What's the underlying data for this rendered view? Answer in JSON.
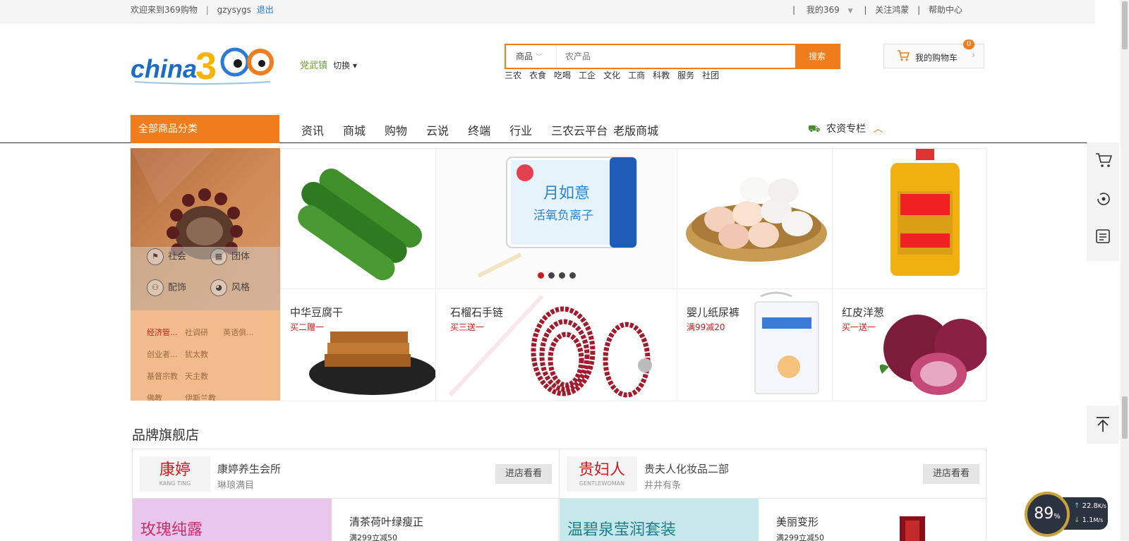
{
  "topbar": {
    "welcome": "欢迎来到369购物",
    "username": "gzysygs",
    "logout": "退出",
    "my369": "我的369",
    "follow": "关注鸿蒙",
    "help": "帮助中心"
  },
  "header": {
    "logo_text": "china369",
    "city": "党武镇",
    "city_switch": "切换",
    "search_category": "商品",
    "search_placeholder": "农产品",
    "search_button": "搜索",
    "hotwords": [
      "三农",
      "衣食",
      "吃喝",
      "工企",
      "文化",
      "工商",
      "科教",
      "服务",
      "社团"
    ],
    "cart_label": "我的购物车",
    "cart_count": "0"
  },
  "nav": {
    "all_categories": "全部商品分类",
    "items": [
      "资讯",
      "商城",
      "购物",
      "云说",
      "终端",
      "行业",
      "三农云平台",
      "老版商城"
    ],
    "special": "农资专栏"
  },
  "sidebar": {
    "items": [
      "社会",
      "团体",
      "配饰",
      "风格"
    ],
    "links": [
      "经济管...",
      "社调研",
      "英语俱...",
      "创业者...",
      "犹太教",
      "基督宗教",
      "天主教",
      "佛教",
      "伊斯兰教"
    ]
  },
  "promos": [
    {
      "title": "中华豆腐干",
      "sub": "买二赠一"
    },
    {
      "title": "石榴石手链",
      "sub": "买三送一"
    },
    {
      "title": "婴儿纸尿裤",
      "sub": "满99减20"
    },
    {
      "title": "红皮洋葱",
      "sub": "买一送一"
    }
  ],
  "banner": {
    "brand_label": "月如意",
    "brand_sub": "活氧负离子",
    "dots": 4,
    "active_dot": 0
  },
  "brands": {
    "section_title": "品牌旗舰店",
    "stores": [
      {
        "logo": "康婷",
        "logo_en": "KANG TING",
        "name": "康婷养生会所",
        "slogan": "琳琅满目",
        "enter": "进店看看",
        "banner_text": "玫瑰纯露",
        "banner_color": "#e9c6ec",
        "product_title": "清茶荷叶绿瘦正",
        "product_sub": "满299立减50"
      },
      {
        "logo": "贵妇人",
        "logo_en": "GENTLEWOMAN",
        "name": "贵夫人化妆品二部",
        "slogan": "井井有条",
        "enter": "进店看看",
        "banner_text": "温碧泉莹润套装",
        "banner_color": "#c5e9ea",
        "product_title": "美丽变形",
        "product_sub": "满299立减50"
      }
    ]
  },
  "speed": {
    "percent": "89",
    "unit": "%",
    "up": "22.8",
    "up_unit": "K/s",
    "down": "1.1",
    "down_unit": "M/s"
  },
  "colors": {
    "accent": "#f07c1c",
    "promo_red": "#d0191a",
    "city_green": "#6aa22c"
  }
}
